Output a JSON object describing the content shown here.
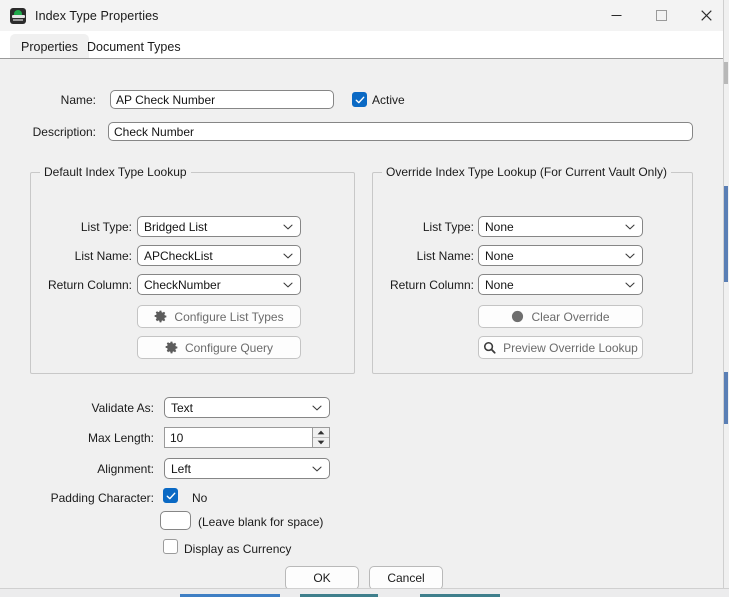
{
  "window": {
    "title": "Index Type Properties",
    "icon": "app-dome-icon",
    "controls": {
      "minimize": "minimize-icon",
      "maximize": "maximize-icon",
      "close": "close-icon"
    }
  },
  "tabs": [
    {
      "label": "Properties",
      "active": true
    },
    {
      "label": "Document Types",
      "active": false
    }
  ],
  "form": {
    "name_label": "Name:",
    "name_value": "AP Check Number",
    "active_label": "Active",
    "active_checked": true,
    "description_label": "Description:",
    "description_value": "Check Number"
  },
  "default_lookup": {
    "title": "Default Index Type Lookup",
    "list_type_label": "List Type:",
    "list_type_value": "Bridged List",
    "list_name_label": "List Name:",
    "list_name_value": "APCheckList",
    "return_column_label": "Return Column:",
    "return_column_value": "CheckNumber",
    "configure_list_types_button": "Configure List Types",
    "configure_query_button": "Configure Query"
  },
  "override_lookup": {
    "title": "Override Index Type Lookup (For Current Vault Only)",
    "list_type_label": "List Type:",
    "list_type_value": "None",
    "list_name_label": "List Name:",
    "list_name_value": "None",
    "return_column_label": "Return Column:",
    "return_column_value": "None",
    "clear_override_button": "Clear Override",
    "preview_override_button": "Preview Override Lookup"
  },
  "validation": {
    "validate_as_label": "Validate As:",
    "validate_as_value": "Text",
    "max_length_label": "Max Length:",
    "max_length_value": "10",
    "alignment_label": "Alignment:",
    "alignment_value": "Left",
    "padding_character_label": "Padding Character:",
    "padding_no_label": "No",
    "padding_checked": true,
    "padding_char_value": "",
    "padding_hint": "(Leave blank for space)",
    "display_as_currency_label": "Display as Currency",
    "display_as_currency_checked": false
  },
  "dialog_buttons": {
    "ok": "OK",
    "cancel": "Cancel"
  },
  "colors": {
    "accent": "#0a69c4",
    "window_bg": "#f0f0f0",
    "titlebar_bg": "#f3f3f3",
    "field_border": "#868686",
    "group_border": "#c8c8c8",
    "disabled_text": "#6b6b6b",
    "taskbar_accent": "#3f7fc4",
    "taskbar_accent_2": "#3f7f8c"
  }
}
